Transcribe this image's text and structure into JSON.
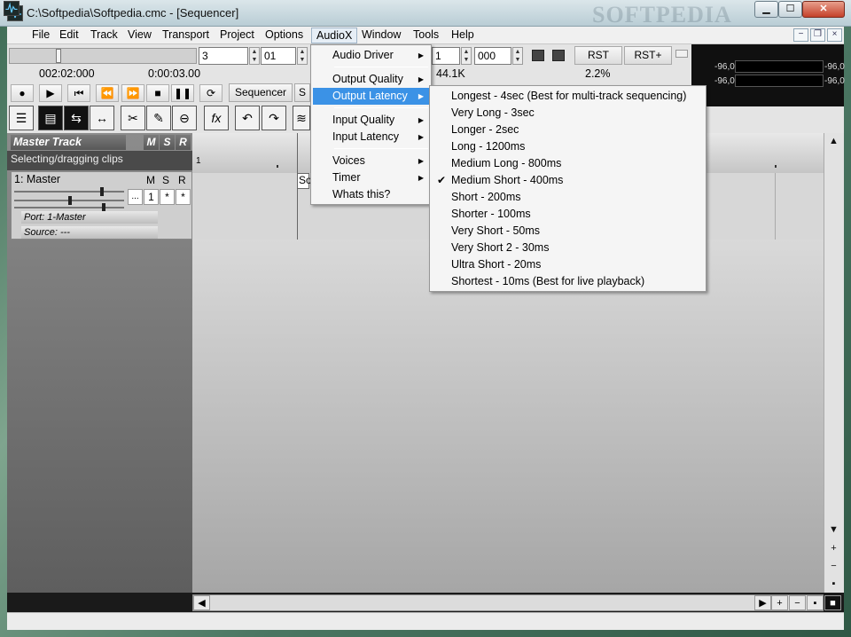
{
  "window": {
    "title": "C:\\Softpedia\\Softpedia.cmc - [Sequencer]",
    "watermark": "SOFTPEDIA",
    "min_glyph": "▁",
    "max_glyph": "☐",
    "close_glyph": "✕"
  },
  "menubar": {
    "items": [
      "File",
      "Edit",
      "Track",
      "View",
      "Transport",
      "Project",
      "Options",
      "AudioX",
      "Window",
      "Tools",
      "Help"
    ],
    "mdi_min": "−",
    "mdi_restore": "❐",
    "mdi_close": "×"
  },
  "transport": {
    "time1": "002:02:000",
    "time2": "0:00:03.00",
    "field_a": "3",
    "field_b": "01",
    "field_c": "1",
    "field_d": "000",
    "rate": "44.1K",
    "cpu": "2.2%",
    "rst": "RST",
    "rst_plus": "RST+",
    "sequencer_tab": "Sequencer",
    "second_tab": "S"
  },
  "meters": {
    "left_top": "-96,0",
    "right_top": "-96,0",
    "left_bottom": "-96,0",
    "right_bottom": "-96,0"
  },
  "tracks": {
    "master_title": "Master Track",
    "m": "M",
    "s": "S",
    "r": "R",
    "status": "Selecting/dragging clips",
    "track1_name": "1: Master",
    "track1_m": "M",
    "track1_s": "S",
    "track1_r": "R",
    "dots": "...",
    "one": "1",
    "star1": "*",
    "star2": "*",
    "port": "Port: 1-Master",
    "source": "Source: ---",
    "timeline_marker": "1",
    "clip_label": "So"
  },
  "audiox_menu": {
    "items": [
      "Audio Driver",
      "Output Quality",
      "Output Latency",
      "Input Quality",
      "Input Latency",
      "Voices",
      "Timer",
      "Whats this?"
    ]
  },
  "latency_menu": {
    "items": [
      "Longest - 4sec (Best for multi-track sequencing)",
      "Very Long - 3sec",
      "Longer - 2sec",
      "Long - 1200ms",
      "Medium Long - 800ms",
      "Medium Short - 400ms",
      "Short - 200ms",
      "Shorter - 100ms",
      "Very Short - 50ms",
      "Very Short 2 - 30ms",
      "Ultra Short - 20ms",
      "Shortest - 10ms (Best for live playback)"
    ],
    "checked": "Medium Short - 400ms",
    "check_glyph": "✔"
  },
  "colors": {
    "highlight": "#3b92e6",
    "menu_bg": "#f5f5f5"
  }
}
